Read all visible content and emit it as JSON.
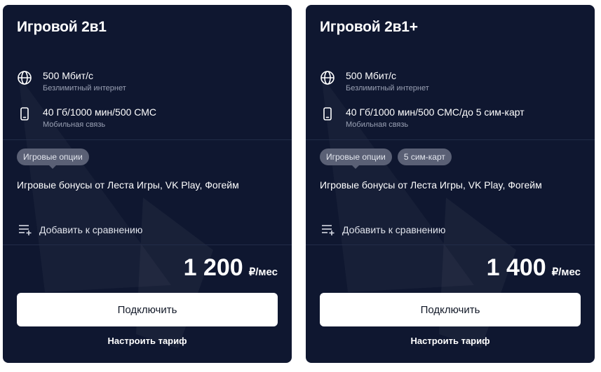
{
  "tariffs": [
    {
      "title": "Игровой 2в1",
      "internet": {
        "title": "500 Мбит/с",
        "subtitle": "Безлимитный интернет",
        "icon": "globe-icon"
      },
      "mobile": {
        "title": "40 Гб/1000 мин/500 СМС",
        "subtitle": "Мобильная связь",
        "icon": "phone-icon"
      },
      "tags": [
        "Игровые опции"
      ],
      "bonus": "Игровые бонусы от Леста Игры, VK Play, Фогейм",
      "compare_label": "Добавить к сравнению",
      "price_amount": "1 200",
      "price_unit": "₽/мес",
      "connect_label": "Подключить",
      "configure_label": "Настроить тариф"
    },
    {
      "title": "Игровой 2в1+",
      "internet": {
        "title": "500 Мбит/с",
        "subtitle": "Безлимитный интернет",
        "icon": "globe-icon"
      },
      "mobile": {
        "title": "40 Гб/1000 мин/500 СМС/до 5 сим-карт",
        "subtitle": "Мобильная связь",
        "icon": "phone-icon"
      },
      "tags": [
        "Игровые опции",
        "5 сим-карт"
      ],
      "bonus": "Игровые бонусы от Леста Игры, VK Play, Фогейм",
      "compare_label": "Добавить к сравнению",
      "price_amount": "1 400",
      "price_unit": "₽/мес",
      "connect_label": "Подключить",
      "configure_label": "Настроить тариф"
    }
  ],
  "colors": {
    "card_bg": "#0f1730",
    "tag_bg": "#5a6075",
    "subtitle": "#9aa1b4",
    "button_bg": "#ffffff",
    "button_text": "#111827"
  }
}
